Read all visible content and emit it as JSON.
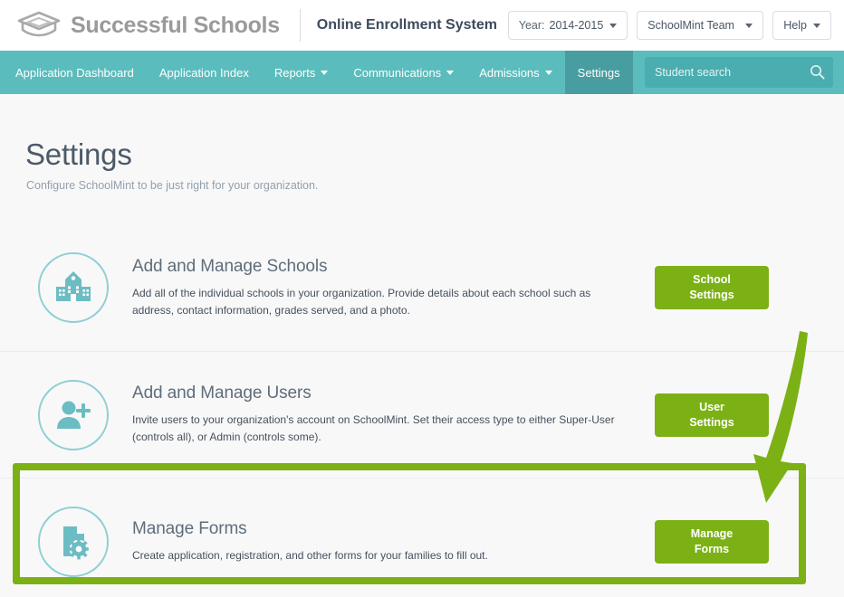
{
  "header": {
    "logo_icon": "graduation-cap-icon",
    "brand_name": "Successful Schools",
    "app_title": "Online Enrollment System",
    "year_label": "Year:",
    "year_value": "2014-2015",
    "team_label": "SchoolMint Team",
    "help_label": "Help"
  },
  "nav": {
    "items": [
      {
        "label": "Application Dashboard",
        "caret": false,
        "active": false
      },
      {
        "label": "Application Index",
        "caret": false,
        "active": false
      },
      {
        "label": "Reports",
        "caret": true,
        "active": false
      },
      {
        "label": "Communications",
        "caret": true,
        "active": false
      },
      {
        "label": "Admissions",
        "caret": true,
        "active": false
      },
      {
        "label": "Settings",
        "caret": false,
        "active": true
      }
    ],
    "search_placeholder": "Student search",
    "search_value": "",
    "search_icon": "search-icon"
  },
  "page": {
    "title": "Settings",
    "subtitle": "Configure SchoolMint to be just right for your organization."
  },
  "rows": [
    {
      "icon": "school-building-icon",
      "title": "Add and Manage Schools",
      "desc": "Add all of the individual schools in your organization. Provide details about each school such as address, contact information, grades served, and a photo.",
      "button_line1": "School",
      "button_line2": "Settings"
    },
    {
      "icon": "add-user-icon",
      "title": "Add and Manage Users",
      "desc": "Invite users to your organization's account on SchoolMint. Set their access type to either Super-User (controls all), or Admin (controls some).",
      "button_line1": "User",
      "button_line2": "Settings"
    },
    {
      "icon": "document-gear-icon",
      "title": "Manage Forms",
      "desc": "Create application, registration, and other forms for your families to fill out.",
      "button_line1": "Manage",
      "button_line2": "Forms"
    }
  ],
  "annotation": {
    "highlight_color": "#7cb116",
    "arrow_color": "#7cb116",
    "target": "Manage Forms"
  },
  "colors": {
    "nav_teal": "#5bbcbd",
    "nav_teal_active": "#479d9f",
    "accent_green": "#7cb116",
    "icon_teal": "#6cbcc4"
  }
}
